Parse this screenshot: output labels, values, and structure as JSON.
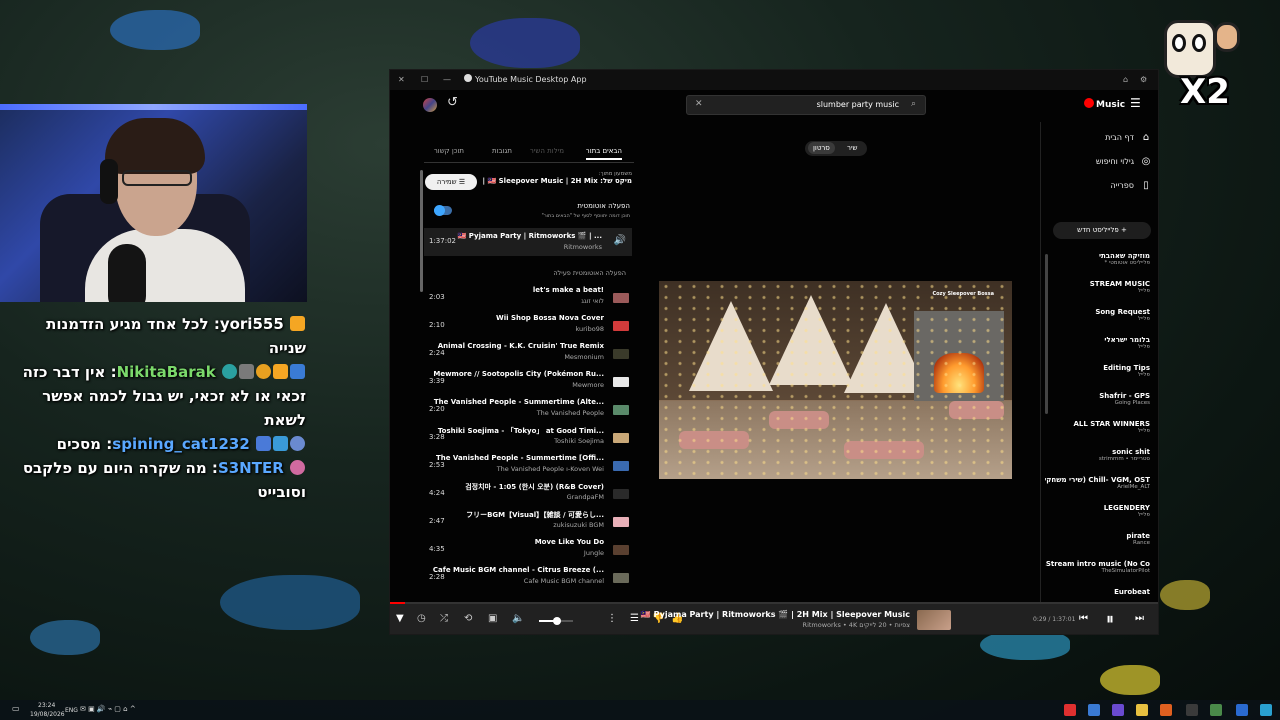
{
  "window": {
    "title": "YouTube Music Desktop App",
    "controls": {
      "close": "✕",
      "maximize": "☐",
      "minimize": "—"
    }
  },
  "header": {
    "search_query": "slumber party music",
    "clear_icon": "✕",
    "logo_text": "Music",
    "brand_color": "#ff0000"
  },
  "sidebar": {
    "nav": [
      {
        "label": "דף הבית",
        "icon": "home-icon",
        "glyph": "⌂"
      },
      {
        "label": "גילוי וחיפוש",
        "icon": "explore-icon",
        "glyph": "◎"
      },
      {
        "label": "ספרייה",
        "icon": "library-icon",
        "glyph": "▯"
      }
    ],
    "new_playlist": "+ פלייליסט חדש",
    "playlists": [
      {
        "title": "מוזיקה שאהבתי",
        "sub": "פלייליסט אוטומטי *"
      },
      {
        "title": "STREAM MUSIC",
        "sub": "פלייל"
      },
      {
        "title": "Song Request",
        "sub": "פלייל"
      },
      {
        "title": "בלומר ישראלי",
        "sub": "פלייל"
      },
      {
        "title": "Editing Tips",
        "sub": "פלייל"
      },
      {
        "title": "Shafrir - GPS",
        "sub": "Going Places"
      },
      {
        "title": "ALL STAR WINNERS",
        "sub": "פלייל"
      },
      {
        "title": "sonic shit",
        "sub": "סטריימר • strimmm"
      },
      {
        "title": "Chill- VGM, OST (שירי משחקים)",
        "sub": "ArielMe_ALT"
      },
      {
        "title": "LEGENDERY",
        "sub": "פלייל"
      },
      {
        "title": "pirate",
        "sub": "Rance"
      },
      {
        "title": "Stream intro music (No Co...",
        "sub": "TheSimulatorPilot"
      },
      {
        "title": "Eurobeat",
        "sub": ""
      }
    ]
  },
  "queue": {
    "tabs": [
      "הבאים בתור",
      "מילות השיר",
      "תגובות",
      "תוכן קשור"
    ],
    "save_label": "שמירה",
    "source_label": "משמעון מתוך:",
    "source_value": "מיקס של: 🇲🇾 Sleepover Music | 2H Mix | 🎬 ...",
    "autoplay_title": "הפעלה אוטומטית",
    "autoplay_desc": "תוכן דומה יתווסף לסוף של \"הבאים בתור\"",
    "now_playing": {
      "duration": "1:37:02",
      "title": "🇲🇾 Pyjama Party | Ritmoworks 🎬 | ...",
      "artist": "Ritmoworks"
    },
    "section_label": "הפעלה האוטומטית פעילה",
    "items": [
      {
        "duration": "2:03",
        "title": "let's make a beat!",
        "artist": "לואי זוגג",
        "thumb": "#9b5a5a"
      },
      {
        "duration": "2:10",
        "title": "Wii Shop Bossa Nova Cover",
        "artist": "kuribo98",
        "thumb": "#d23b3b"
      },
      {
        "duration": "2:24",
        "title": "Animal Crossing - K.K. Cruisin' True Remix",
        "artist": "Mesmonium",
        "thumb": "#3a3a2a"
      },
      {
        "duration": "3:39",
        "title": "Mewmore // Sootopolis City (Pokémon Ru...",
        "artist": "Mewmore",
        "thumb": "#e8e8e8"
      },
      {
        "duration": "2:20",
        "title": "The Vanished People - Summertime (Alte...",
        "artist": "The Vanished People",
        "thumb": "#5a8a6a"
      },
      {
        "duration": "3:28",
        "title": "Toshiki Soejima - 「Tokyo」 at Good Timi...",
        "artist": "Toshiki Soejima",
        "thumb": "#c9a878"
      },
      {
        "duration": "2:53",
        "title": "The Vanished People - Summertime [Offi...",
        "artist": "The Vanished People ו-Koven Wei",
        "thumb": "#3a6ab0"
      },
      {
        "duration": "4:24",
        "title": "검정치마 - 1:05 (한시 오분) (R&B Cover)",
        "artist": "GrandpaFM",
        "thumb": "#2a2a2a"
      },
      {
        "duration": "2:47",
        "title": "フリーBGM【Visual】【雑談 / 可愛らし...",
        "artist": "zukisuzuki BGM",
        "thumb": "#e8b0b8"
      },
      {
        "duration": "4:35",
        "title": "Move Like You Do",
        "artist": "Jungle",
        "thumb": "#5a4030"
      },
      {
        "duration": "2:28",
        "title": "Cafe Music BGM channel - Citrus Breeze (...",
        "artist": "Cafe Music BGM channel",
        "thumb": "#6a6a5a"
      }
    ]
  },
  "player": {
    "toggle": {
      "song": "שיר",
      "video": "סרטון"
    },
    "art_label": "Cozy Sleepover Bossa",
    "now_title": "🇲🇾 Pyjama Party | Ritmoworks 🎬 | 2H Mix | Sleepover Music",
    "now_sub": "Ritmoworks • 4K צפיות • 20 לייקים",
    "time": "0:29 / 1:37:01",
    "progress_fraction": 0.02,
    "volume_fraction": 0.5
  },
  "chat": {
    "lines": [
      {
        "user": "yori555",
        "msg": "לכל אחד מגיע הזדמנות שנייה",
        "color": "#ffffff",
        "badges": [
          "#f5a623"
        ]
      },
      {
        "user": "NikitaBarak",
        "msg": "אין דבר כזה זכאי או לא זכאי, יש גבול לכמה אפשר לשאת",
        "color": "#7bd96b",
        "badges": [
          "#3a7bd5",
          "#f5a623",
          "#e8a020",
          "#7a7a7a",
          "#2aa0a0"
        ]
      },
      {
        "user": "spining_cat1232",
        "msg": "מסכים",
        "color": "#5aa8ff",
        "badges": [
          "#6a8ad0",
          "#3a9ad8",
          "#4a7ad8"
        ]
      },
      {
        "user": "S3NTER",
        "msg": "מה שקרה היום עם פלקבס וסובייט",
        "color": "#5aa8ff",
        "badges": [
          "#d06aa0"
        ]
      }
    ]
  },
  "overlay": {
    "multiplier": "X2"
  },
  "taskbar": {
    "time": "23:24",
    "date": "19/08/2026",
    "lang": "ENG"
  }
}
